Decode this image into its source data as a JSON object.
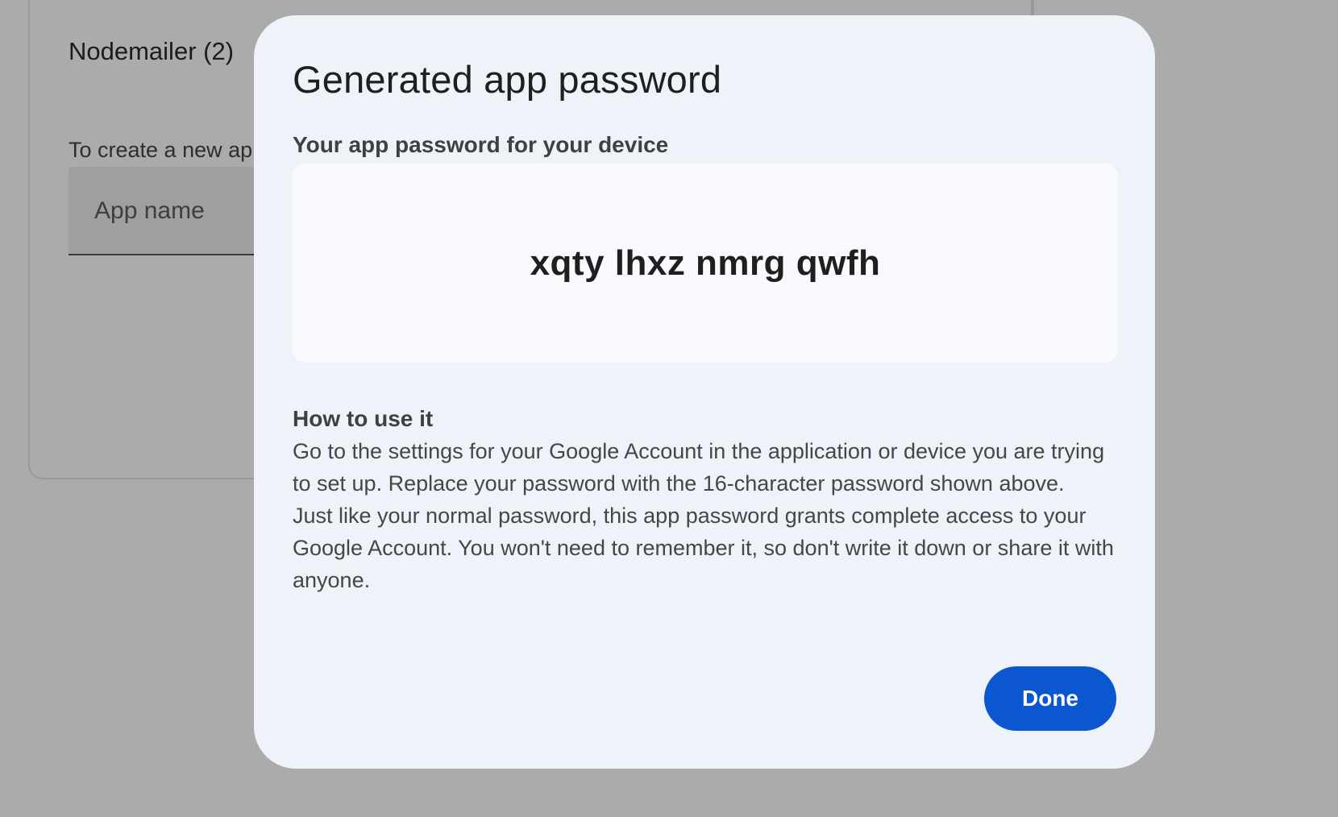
{
  "background": {
    "section_title": "Nodemailer (2)",
    "description_fragment": "To create a new ap",
    "app_name_placeholder": "App name"
  },
  "dialog": {
    "title": "Generated app password",
    "subheading": "Your app password for your device",
    "password": "xqty lhxz nmrg qwfh",
    "how_to_heading": "How to use it",
    "how_to_paragraphs": [
      "Go to the settings for your Google Account in the application or device you are trying to set up. Replace your password with the 16-character password shown above.",
      "Just like your normal password, this app password grants complete access to your Google Account. You won't need to remember it, so don't write it down or share it with anyone."
    ],
    "done_label": "Done"
  },
  "colors": {
    "scrim": "#ababab",
    "dialog_background": "#eef2f9",
    "password_box_background": "#f8fafd",
    "primary_button": "#0b57d0"
  }
}
